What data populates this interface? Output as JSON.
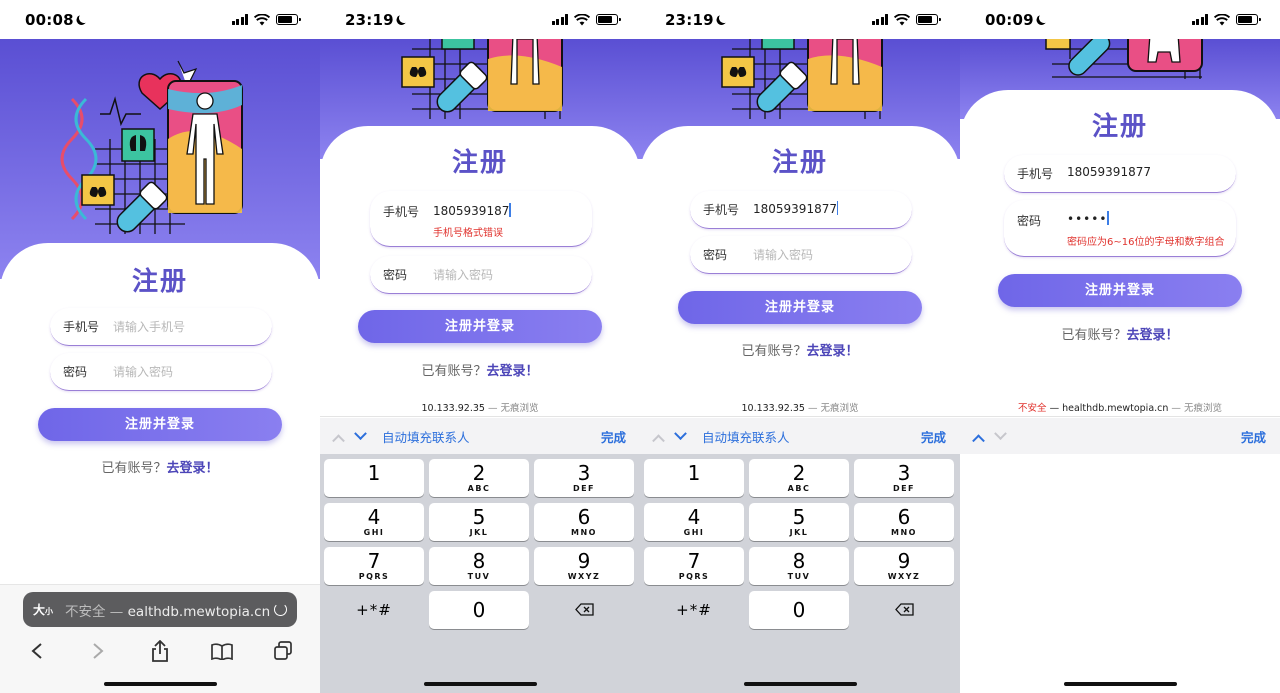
{
  "screens": [
    {
      "time": "00:08",
      "title": "注册",
      "phone_label": "手机号",
      "phone_placeholder": "请输入手机号",
      "password_label": "密码",
      "password_placeholder": "请输入密码",
      "submit": "注册并登录",
      "has_account": "已有账号？",
      "login_link": "去登录！",
      "url_bar": {
        "text_size": "大",
        "text_size_small": "小",
        "insecure": "不安全 — ",
        "domain": "ealthdb.mewtopia.cn"
      }
    },
    {
      "time": "23:19",
      "title": "注册",
      "phone_label": "手机号",
      "phone_value": "1805939187",
      "phone_error": "手机号格式错误",
      "password_label": "密码",
      "password_placeholder": "请输入密码",
      "submit": "注册并登录",
      "has_account": "已有账号？",
      "login_link": "去登录！",
      "url": "10.133.92.35",
      "private": " — 无痕浏览",
      "autofill": "自动填充联系人",
      "done": "完成"
    },
    {
      "time": "23:19",
      "title": "注册",
      "phone_label": "手机号",
      "phone_value": "18059391877",
      "password_label": "密码",
      "password_placeholder": "请输入密码",
      "submit": "注册并登录",
      "has_account": "已有账号？",
      "login_link": "去登录！",
      "url": "10.133.92.35",
      "private": " — 无痕浏览",
      "autofill": "自动填充联系人",
      "done": "完成"
    },
    {
      "time": "00:09",
      "title": "注册",
      "phone_label": "手机号",
      "phone_value": "18059391877",
      "password_label": "密码",
      "password_value": "•••••",
      "password_error": "密码应为6~16位的字母和数字组合",
      "submit": "注册并登录",
      "has_account": "已有账号？",
      "login_link": "去登录！",
      "insecure": "不安全",
      "url": " — healthdb.mewtopia.cn",
      "private": " — 无痕浏览",
      "done": "完成"
    }
  ],
  "keypad": [
    [
      {
        "n": "1",
        "l": ""
      },
      {
        "n": "2",
        "l": "ABC"
      },
      {
        "n": "3",
        "l": "DEF"
      }
    ],
    [
      {
        "n": "4",
        "l": "GHI"
      },
      {
        "n": "5",
        "l": "JKL"
      },
      {
        "n": "6",
        "l": "MNO"
      }
    ],
    [
      {
        "n": "7",
        "l": "PQRS"
      },
      {
        "n": "8",
        "l": "TUV"
      },
      {
        "n": "9",
        "l": "WXYZ"
      }
    ],
    [
      {
        "n": "+*#",
        "l": ""
      },
      {
        "n": "0",
        "l": ""
      },
      {
        "n": "",
        "l": ""
      }
    ]
  ],
  "colors": {
    "accent": "#5b52c7",
    "button": "#7a70ec",
    "error": "#e0322d",
    "link": "#2c6fdc"
  }
}
